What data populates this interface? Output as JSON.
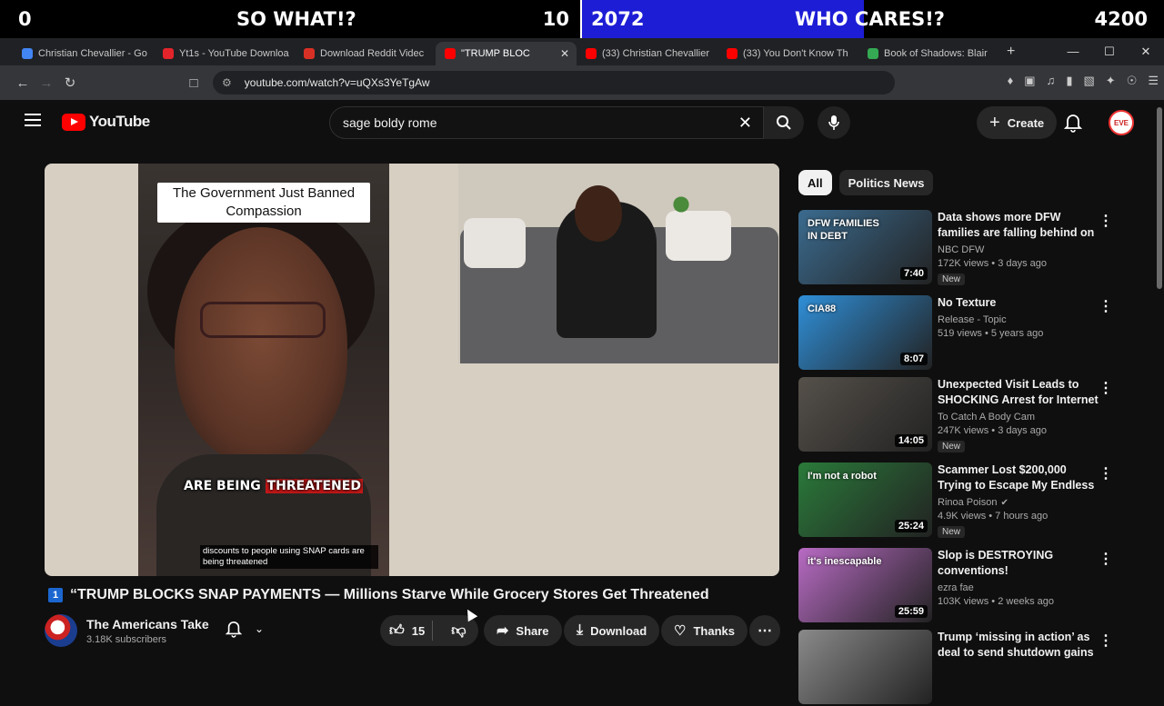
{
  "overlay": {
    "left_score": "0",
    "left_label": "SO WHAT!?",
    "left_count": "10",
    "right_score": "2072",
    "right_label": "WHO CARES!?",
    "right_count": "4200"
  },
  "tabs": [
    {
      "label": "Christian Chevallier - Go",
      "color": "#4285f4"
    },
    {
      "label": "Yt1s - YouTube Downloa",
      "color": "#e3242b"
    },
    {
      "label": "Download Reddit Videc",
      "color": "#d93025"
    },
    {
      "label": "\"TRUMP BLOC",
      "color": "#ff0000",
      "active": true
    },
    {
      "label": "(33) Christian Chevallier",
      "color": "#ff0000"
    },
    {
      "label": "(33) You Don't Know Th",
      "color": "#ff0000"
    },
    {
      "label": "Book of Shadows: Blair",
      "color": "#34a853"
    }
  ],
  "address": {
    "url": "youtube.com/watch?v=uQXs3YeTgAw"
  },
  "header": {
    "logo_text": "YouTube",
    "search_query": "sage boldy rome",
    "create_label": "Create",
    "avatar_text": "EVE"
  },
  "video": {
    "caption_top": "The Government Just Banned Compassion",
    "caption_mid_a": "ARE BEING ",
    "caption_mid_b": "THREATENED",
    "subtitle": "discounts to people using SNAP cards are being threatened",
    "title_badge": "1",
    "title": "“TRUMP BLOCKS SNAP PAYMENTS — Millions Starve While Grocery Stores Get Threatened",
    "channel_name": "The Americans  Take",
    "channel_subs": "3.18K subscribers",
    "likes": "15",
    "share_label": "Share",
    "download_label": "Download",
    "thanks_label": "Thanks"
  },
  "sidebar": {
    "chips": [
      "All",
      "Politics News"
    ],
    "recommendations": [
      {
        "title": "Data shows more DFW families are falling behind on bills",
        "channel": "NBC DFW",
        "views": "172K views • 3 days ago",
        "badge": "New",
        "duration": "7:40",
        "thumb_text": "DFW FAMILIES IN DEBT",
        "thumb_color": "#3b6b8f"
      },
      {
        "title": "No Texture",
        "channel": "Release - Topic",
        "views": "519 views • 5 years ago",
        "badge": "",
        "duration": "8:07",
        "thumb_text": "CIA88",
        "thumb_color": "#2f8fd8"
      },
      {
        "title": "Unexpected Visit Leads to SHOCKING Arrest for Internet ...",
        "channel": "To Catch A Body Cam",
        "views": "247K views • 3 days ago",
        "badge": "New",
        "duration": "14:05",
        "thumb_text": "",
        "thumb_color": "#55504a"
      },
      {
        "title": "Scammer Lost $200,000 Trying to Escape My Endless ...",
        "channel": "Rinoa Poison",
        "views": "4.9K views • 7 hours ago",
        "badge": "New",
        "duration": "25:24",
        "thumb_text": "I'm not a robot",
        "thumb_color": "#2a7a3a"
      },
      {
        "title": "Slop is DESTROYING conventions!",
        "channel": "ezra fae",
        "views": "103K views • 2 weeks ago",
        "badge": "",
        "duration": "25:59",
        "thumb_text": "it's inescapable",
        "thumb_color": "#b86bc4"
      },
      {
        "title": "Trump ‘missing in action’ as deal to send shutdown gains",
        "channel": "",
        "views": "",
        "badge": "",
        "duration": "",
        "thumb_text": "",
        "thumb_color": "#8a8a8a"
      }
    ]
  }
}
